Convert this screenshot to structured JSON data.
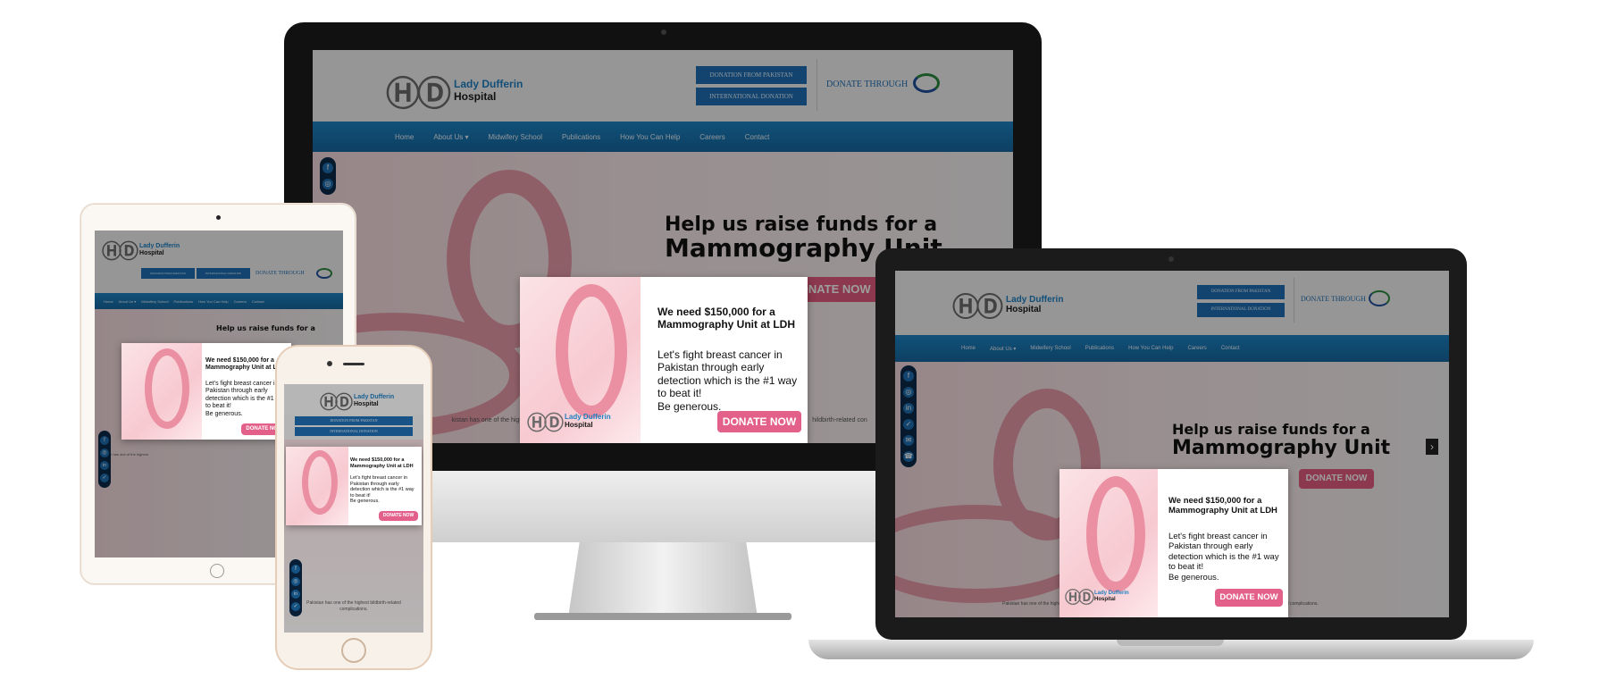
{
  "brand": {
    "line1": "Lady Dufferin",
    "line2": "Hospital",
    "mark": "LDH"
  },
  "donation": {
    "pakistan": "DONATION FROM PAKISTAN",
    "international": "INTERNATIONAL DONATION",
    "through": "DONATE THROUGH"
  },
  "nav": [
    "Home",
    "About Us ▾",
    "Midwifery School",
    "Publications",
    "How You Can Help",
    "Careers",
    "Contact"
  ],
  "hero": {
    "line1": "Help us raise funds for a",
    "line2": "Mammography Unit",
    "button": "DONATE NOW"
  },
  "modal": {
    "heading1": "We need $150,000 for a",
    "heading2": "Mammography Unit at LDH",
    "body1": "Let's fight breast cancer in",
    "body2": "Pakistan through early",
    "body3": "detection which is the #1 way",
    "body4": "to beat it!",
    "body5": "Be generous.",
    "button": "DONATE NOW"
  },
  "content": {
    "intro_a": "Pakistan has one of the highest",
    "intro_b": "bildbirth-related complications.",
    "intro_tail": "kistan has one of the highest",
    "intro_tail2": "hildbirth-related con"
  },
  "arrows": {
    "prev": "‹",
    "next": "›"
  },
  "social_icons": [
    "f",
    "◎",
    "in",
    "✓",
    "✉",
    "☎"
  ],
  "colors": {
    "nav": "#1d83c4",
    "donate": "#e35b7f",
    "button_blue": "#1f6fb3"
  }
}
